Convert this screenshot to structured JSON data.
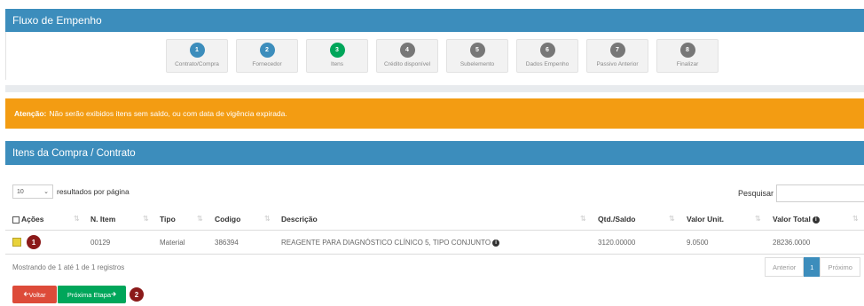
{
  "panel1": {
    "title": "Fluxo de Empenho"
  },
  "steps": [
    {
      "num": "1",
      "label": "Contrato/Compra",
      "color": "#3c8dbc"
    },
    {
      "num": "2",
      "label": "Fornecedor",
      "color": "#3c8dbc"
    },
    {
      "num": "3",
      "label": "Itens",
      "color": "#00a65a"
    },
    {
      "num": "4",
      "label": "Crédito disponível",
      "color": "#777777"
    },
    {
      "num": "5",
      "label": "Subelemento",
      "color": "#777777"
    },
    {
      "num": "6",
      "label": "Dados Empenho",
      "color": "#777777"
    },
    {
      "num": "7",
      "label": "Passivo Anterior",
      "color": "#777777"
    },
    {
      "num": "8",
      "label": "Finalizar",
      "color": "#777777"
    }
  ],
  "alert": {
    "bold": "Atenção:",
    "text": "Não serão exibidos itens sem saldo, ou com data de vigência expirada."
  },
  "panel2": {
    "title": "Itens da Compra / Contrato"
  },
  "length": {
    "value": "10",
    "label": "resultados por página"
  },
  "search": {
    "label": "Pesquisar"
  },
  "columns": {
    "acoes": "Ações",
    "item": "N. Item",
    "tipo": "Tipo",
    "codigo": "Codigo",
    "descricao": "Descrição",
    "qtd": "Qtd./Saldo",
    "unit": "Valor Unit.",
    "total": "Valor Total"
  },
  "row": {
    "badge": "1",
    "item": "00129",
    "tipo": "Material",
    "codigo": "386394",
    "descricao": "REAGENTE PARA DIAGNÓSTICO CLÍNICO 5, TIPO CONJUNTO",
    "qtd": "3120.00000",
    "unit": "9.0500",
    "total": "28236.0000"
  },
  "info": "Mostrando de 1 até 1 de 1 registros",
  "pager": {
    "prev": "Anterior",
    "page": "1",
    "next": "Próximo"
  },
  "buttons": {
    "back": "Voltar",
    "next": "Próxima Etapa",
    "badge": "2"
  },
  "colors": {
    "primary": "#3c8dbc",
    "warning": "#f39c12",
    "success": "#00a65a",
    "danger": "#dd4b39",
    "badge": "#8b1a1a"
  }
}
